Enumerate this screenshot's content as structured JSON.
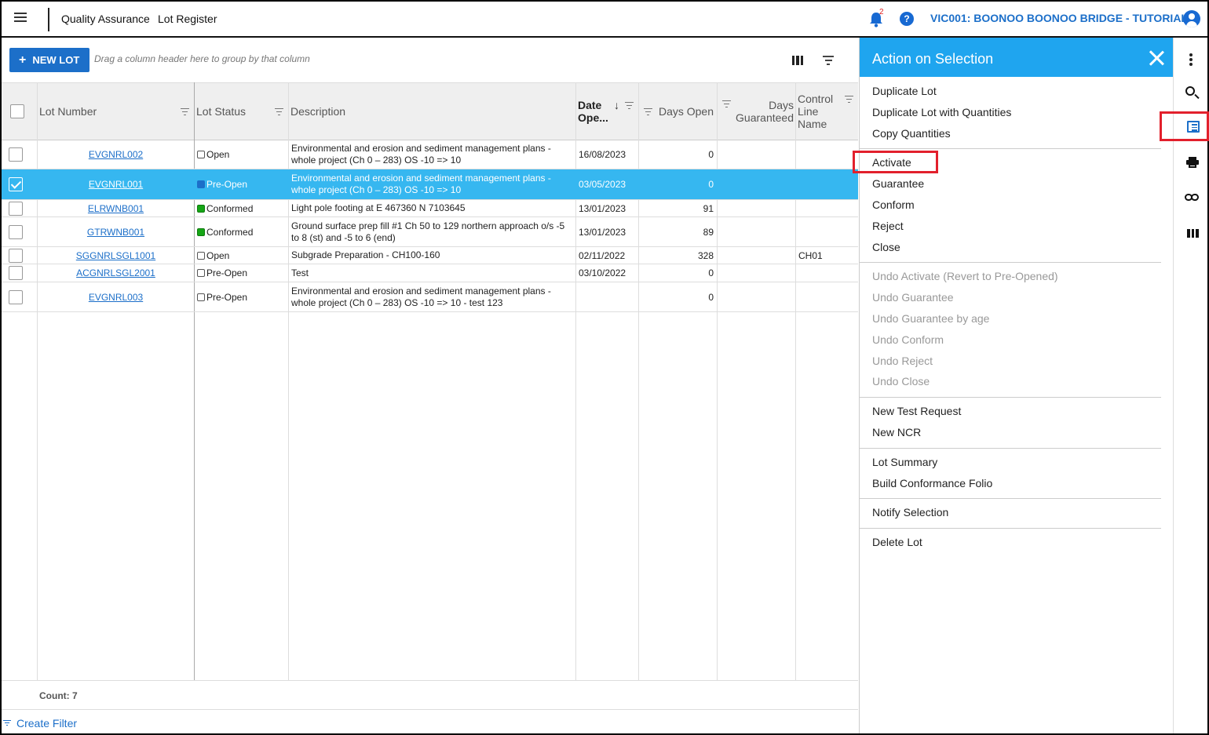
{
  "topbar": {
    "module": "Quality Assurance",
    "page": "Lot Register",
    "notification_count": "2",
    "help_glyph": "?",
    "project": "VIC001: BOONOO BOONOO BRIDGE - TUTORIAL"
  },
  "toolbar": {
    "new_lot_label": "NEW LOT",
    "group_hint": "Drag a column header here to group by that column"
  },
  "grid": {
    "columns": [
      "Lot Number",
      "Lot Status",
      "Description",
      "Date Ope...",
      "Days Open",
      "Days Guaranteed",
      "Control Line Name"
    ],
    "sort_column": "Date Ope...",
    "sort_direction": "descending",
    "rows": [
      {
        "lot": "EVGNRL002",
        "status": "Open",
        "status_color": "none",
        "desc1": "Environmental and erosion and sediment management plans -",
        "desc2": "whole project (Ch 0 – 283) OS -10 => 10",
        "date": "16/08/2023",
        "days_open": "0",
        "guaranteed": "",
        "control_line": ""
      },
      {
        "lot": "EVGNRL001",
        "status": "Pre-Open",
        "status_color": "none",
        "desc1": "Environmental and erosion and sediment management plans -",
        "desc2": "whole project (Ch 0 – 283) OS -10 => 10",
        "date": "03/05/2023",
        "days_open": "0",
        "guaranteed": "",
        "control_line": ""
      },
      {
        "lot": "ELRWNB001",
        "status": "Conformed",
        "status_color": "#16a616",
        "desc1": "Light pole footing at E 467360 N 7103645",
        "desc2": "",
        "date": "13/01/2023",
        "days_open": "91",
        "guaranteed": "",
        "control_line": ""
      },
      {
        "lot": "GTRWNB001",
        "status": "Conformed",
        "status_color": "#16a616",
        "desc1": "Ground surface prep fill #1 Ch 50 to 129 northern approach o/s -5",
        "desc2": "to 8 (st) and -5 to 6 (end)",
        "date": "13/01/2023",
        "days_open": "89",
        "guaranteed": "",
        "control_line": ""
      },
      {
        "lot": "SGGNRLSGL1001",
        "status": "Open",
        "status_color": "none",
        "desc1": "Subgrade Preparation - CH100-160",
        "desc2": "",
        "date": "02/11/2022",
        "days_open": "328",
        "guaranteed": "",
        "control_line": "CH01"
      },
      {
        "lot": "ACGNRLSGL2001",
        "status": "Pre-Open",
        "status_color": "none",
        "desc1": "Test",
        "desc2": "",
        "date": "03/10/2022",
        "days_open": "0",
        "guaranteed": "",
        "control_line": ""
      },
      {
        "lot": "EVGNRL003",
        "status": "Pre-Open",
        "status_color": "none",
        "desc1": "Environmental and erosion and sediment management plans -",
        "desc2": "whole project (Ch 0 – 283) OS -10 => 10 - test 123",
        "date": "",
        "days_open": "0",
        "guaranteed": "",
        "control_line": ""
      }
    ],
    "selected_lot": "EVGNRL001",
    "count_label": "Count: 7",
    "create_filter": "Create Filter"
  },
  "panel": {
    "title": "Action on Selection",
    "groups": [
      [
        {
          "label": "Duplicate Lot",
          "enabled": true
        },
        {
          "label": "Duplicate Lot with Quantities",
          "enabled": true
        },
        {
          "label": "Copy Quantities",
          "enabled": true
        }
      ],
      [
        {
          "label": "Activate",
          "enabled": true
        },
        {
          "label": "Guarantee",
          "enabled": true
        },
        {
          "label": "Conform",
          "enabled": true
        },
        {
          "label": "Reject",
          "enabled": true
        },
        {
          "label": "Close",
          "enabled": true
        }
      ],
      [
        {
          "label": "Undo Activate (Revert to Pre-Opened)",
          "enabled": false
        },
        {
          "label": "Undo Guarantee",
          "enabled": false
        },
        {
          "label": "Undo Guarantee by age",
          "enabled": false
        },
        {
          "label": "Undo Conform",
          "enabled": false
        },
        {
          "label": "Undo Reject",
          "enabled": false
        },
        {
          "label": "Undo Close",
          "enabled": false
        }
      ],
      [
        {
          "label": "New Test Request",
          "enabled": true
        },
        {
          "label": "New NCR",
          "enabled": true
        }
      ],
      [
        {
          "label": "Lot Summary",
          "enabled": true
        },
        {
          "label": "Build Conformance Folio",
          "enabled": true
        }
      ],
      [
        {
          "label": "Notify Selection",
          "enabled": true
        }
      ],
      [
        {
          "label": "Delete Lot",
          "enabled": true
        }
      ]
    ]
  },
  "rail": {
    "icons": [
      "more-vert-icon",
      "search-icon",
      "list-view-icon",
      "print-icon",
      "link-icon",
      "columns-icon"
    ],
    "active_icon": "list-view-icon"
  },
  "colors": {
    "accent": "#1c6fc9",
    "panel_header": "#1fa5ef",
    "selected_row": "#36b7f0",
    "highlight": "#e2202c",
    "conformed": "#16a616"
  }
}
